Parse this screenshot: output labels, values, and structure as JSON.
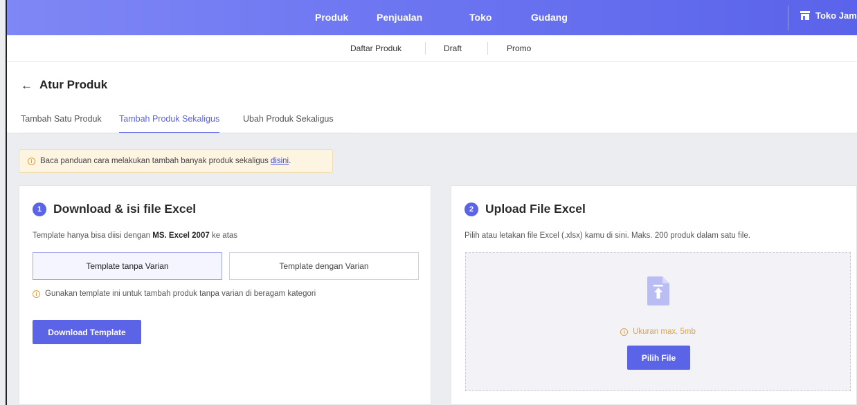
{
  "topnav": {
    "items": [
      "Produk",
      "Penjualan",
      "Toko",
      "Gudang"
    ],
    "store_name": "Toko Jamal"
  },
  "subnav": {
    "items": [
      "Daftar Produk",
      "Draft",
      "Promo"
    ]
  },
  "header": {
    "back_icon": "←",
    "title": "Atur Produk",
    "tabs": [
      "Tambah Satu Produk",
      "Tambah Produk Sekaligus",
      "Ubah Produk Sekaligus"
    ],
    "active_tab": "Tambah Produk Sekaligus"
  },
  "banner": {
    "text": "Baca panduan cara melakukan tambah banyak produk sekaligus",
    "link": "disini",
    "suffix": "."
  },
  "download_card": {
    "step": "1",
    "title": "Download & isi file Excel",
    "desc_prefix": "Template hanya bisa diisi dengan",
    "desc_bold": "MS. Excel 2007",
    "desc_suffix": "ke atas",
    "template_options": [
      "Template tanpa Varian",
      "Template dengan Varian"
    ],
    "selected_template": "Template tanpa Varian",
    "hint": "Gunakan template ini untuk tambah produk tanpa varian di beragam kategori",
    "button": "Download Template"
  },
  "upload_card": {
    "step": "2",
    "title": "Upload File Excel",
    "desc": "Pilih atau letakan file Excel (.xlsx) kamu di sini. Maks. 200 produk dalam satu file.",
    "size_note": "Ukuran max. 5mb",
    "button": "Pilih File"
  },
  "colors": {
    "accent": "#5b63e6",
    "warning": "#e2a13b",
    "banner_bg": "#fdf4e2"
  },
  "icons": {
    "store": "store-icon",
    "back": "arrow-left-icon",
    "info": "info-icon",
    "file_upload": "file-upload-icon"
  }
}
